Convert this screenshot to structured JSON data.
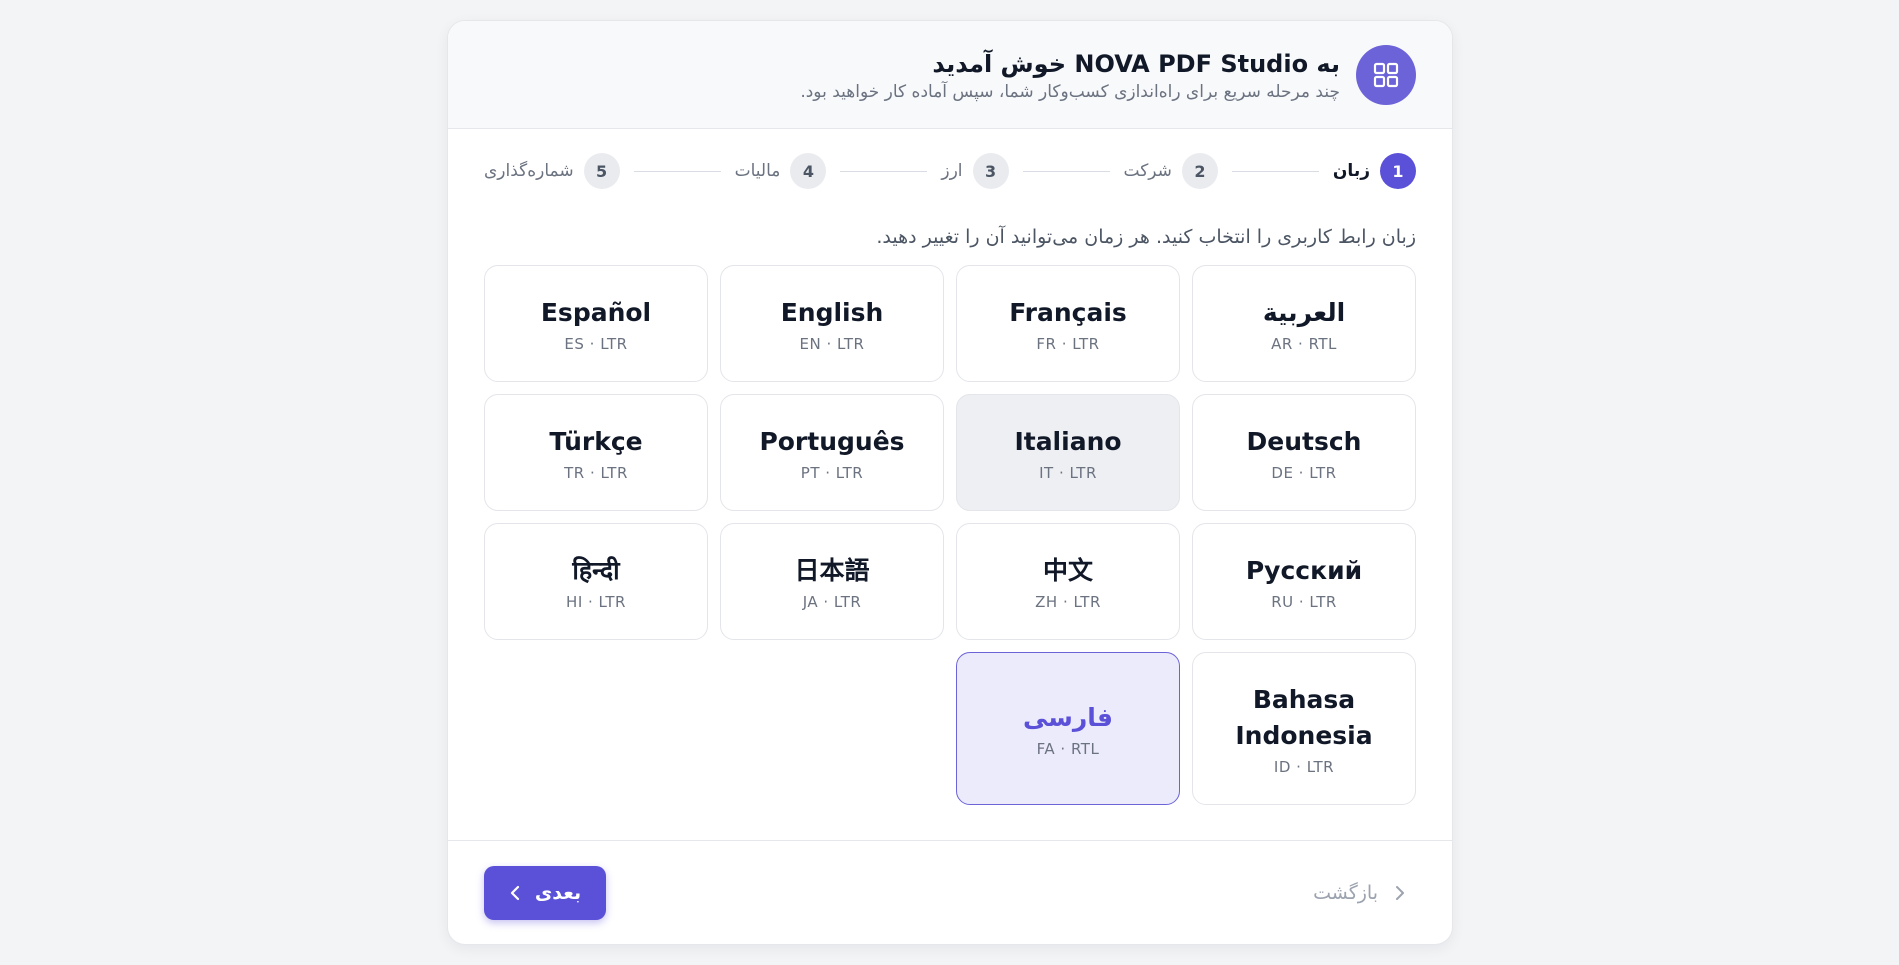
{
  "header": {
    "title": "به NOVA PDF Studio خوش آمدید",
    "subtitle": "چند مرحله سریع برای راه‌اندازی کسب‌وکار شما، سپس آماده کار خواهید بود."
  },
  "steps": [
    {
      "num": "1",
      "label": "زبان"
    },
    {
      "num": "2",
      "label": "شرکت"
    },
    {
      "num": "3",
      "label": "ارز"
    },
    {
      "num": "4",
      "label": "مالیات"
    },
    {
      "num": "5",
      "label": "شماره‌گذاری"
    }
  ],
  "instruction": "زبان رابط کاربری را انتخاب کنید. هر زمان می‌توانید آن را تغییر دهید.",
  "languages": [
    {
      "name": "العربية",
      "code": "AR · RTL"
    },
    {
      "name": "Français",
      "code": "FR · LTR"
    },
    {
      "name": "English",
      "code": "EN · LTR"
    },
    {
      "name": "Español",
      "code": "ES · LTR"
    },
    {
      "name": "Deutsch",
      "code": "DE · LTR"
    },
    {
      "name": "Italiano",
      "code": "IT · LTR"
    },
    {
      "name": "Português",
      "code": "PT · LTR"
    },
    {
      "name": "Türkçe",
      "code": "TR · LTR"
    },
    {
      "name": "Русский",
      "code": "RU · LTR"
    },
    {
      "name": "中文",
      "code": "ZH · LTR"
    },
    {
      "name": "日本語",
      "code": "JA · LTR"
    },
    {
      "name": "हिन्दी",
      "code": "HI · LTR"
    },
    {
      "name": "Bahasa Indonesia",
      "code": "ID · LTR"
    },
    {
      "name": "فارسی",
      "code": "FA · RTL"
    }
  ],
  "footer": {
    "next_label": "بعدی",
    "back_label": "بازگشت"
  },
  "colors": {
    "accent": "#5b51d8",
    "selected_bg": "#ecebfb"
  },
  "icons": {
    "app": "grid-icon",
    "next": "chevron-left-icon",
    "back": "chevron-right-icon"
  }
}
